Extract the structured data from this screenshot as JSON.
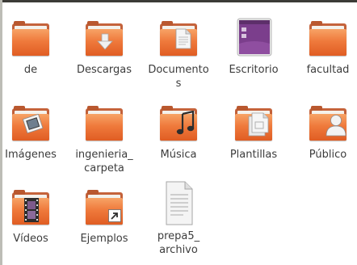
{
  "colors": {
    "folder_orange": "#ef7a3c",
    "folder_dark": "#b9582f",
    "label_text": "#3c3c3c",
    "background": "#ffffff",
    "desktop_purple": "#7b3e8c"
  },
  "items": [
    {
      "label": "de",
      "icon": "folder-icon"
    },
    {
      "label": "Descargas",
      "icon": "downloads-folder-icon"
    },
    {
      "label": "Documento\ns",
      "icon": "documents-folder-icon"
    },
    {
      "label": "Escritorio",
      "icon": "desktop-folder-icon"
    },
    {
      "label": "facultad",
      "icon": "folder-icon"
    },
    {
      "label": "Imágenes",
      "icon": "pictures-folder-icon"
    },
    {
      "label": "ingenieria_\ncarpeta",
      "icon": "folder-icon"
    },
    {
      "label": "Música",
      "icon": "music-folder-icon"
    },
    {
      "label": "Plantillas",
      "icon": "templates-folder-icon"
    },
    {
      "label": "Público",
      "icon": "public-folder-icon"
    },
    {
      "label": "Vídeos",
      "icon": "videos-folder-icon"
    },
    {
      "label": "Ejemplos",
      "icon": "examples-folder-icon"
    },
    {
      "label": "prepa5_\narchivo",
      "icon": "text-file-icon"
    }
  ]
}
